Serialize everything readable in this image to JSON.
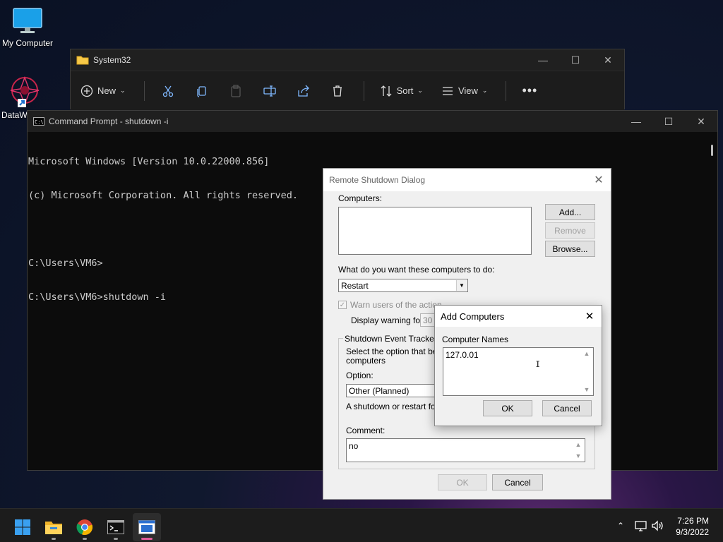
{
  "desktop": {
    "icons": [
      {
        "label": "My Computer"
      },
      {
        "label": "DataW"
      }
    ]
  },
  "explorer": {
    "title": "System32",
    "toolbar": {
      "new_label": "New",
      "sort_label": "Sort",
      "view_label": "View"
    }
  },
  "cmd": {
    "title": "Command Prompt - shutdown  -i",
    "lines": [
      "Microsoft Windows [Version 10.0.22000.856]",
      "(c) Microsoft Corporation. All rights reserved.",
      "",
      "C:\\Users\\VM6>",
      "C:\\Users\\VM6>shutdown -i"
    ]
  },
  "remote_shutdown": {
    "title": "Remote Shutdown Dialog",
    "computers_label": "Computers:",
    "add_label": "Add...",
    "remove_label": "Remove",
    "browse_label": "Browse...",
    "action_label": "What do you want these computers to do:",
    "action_value": "Restart",
    "warn_label": "Warn users of the action",
    "warn_checked": true,
    "display_warning_label": "Display warning for",
    "display_warning_value": "30",
    "tracker_legend": "Shutdown Event Tracker",
    "tracker_desc_1": "Select the option that best",
    "tracker_desc_2": "computers",
    "option_label": "Option:",
    "option_value": "Other (Planned)",
    "option_desc": "A shutdown or restart for ar",
    "comment_label": "Comment:",
    "comment_value": "no",
    "ok_label": "OK",
    "cancel_label": "Cancel"
  },
  "add_computers": {
    "title": "Add Computers",
    "names_label": "Computer Names",
    "names_value": "127.0.01",
    "ok_label": "OK",
    "cancel_label": "Cancel"
  },
  "taskbar": {
    "apps": [
      "start-icon",
      "file-explorer-icon",
      "chrome-icon",
      "terminal-icon",
      "remote-shutdown-app-icon"
    ],
    "time": "7:26 PM",
    "date": "9/3/2022"
  }
}
